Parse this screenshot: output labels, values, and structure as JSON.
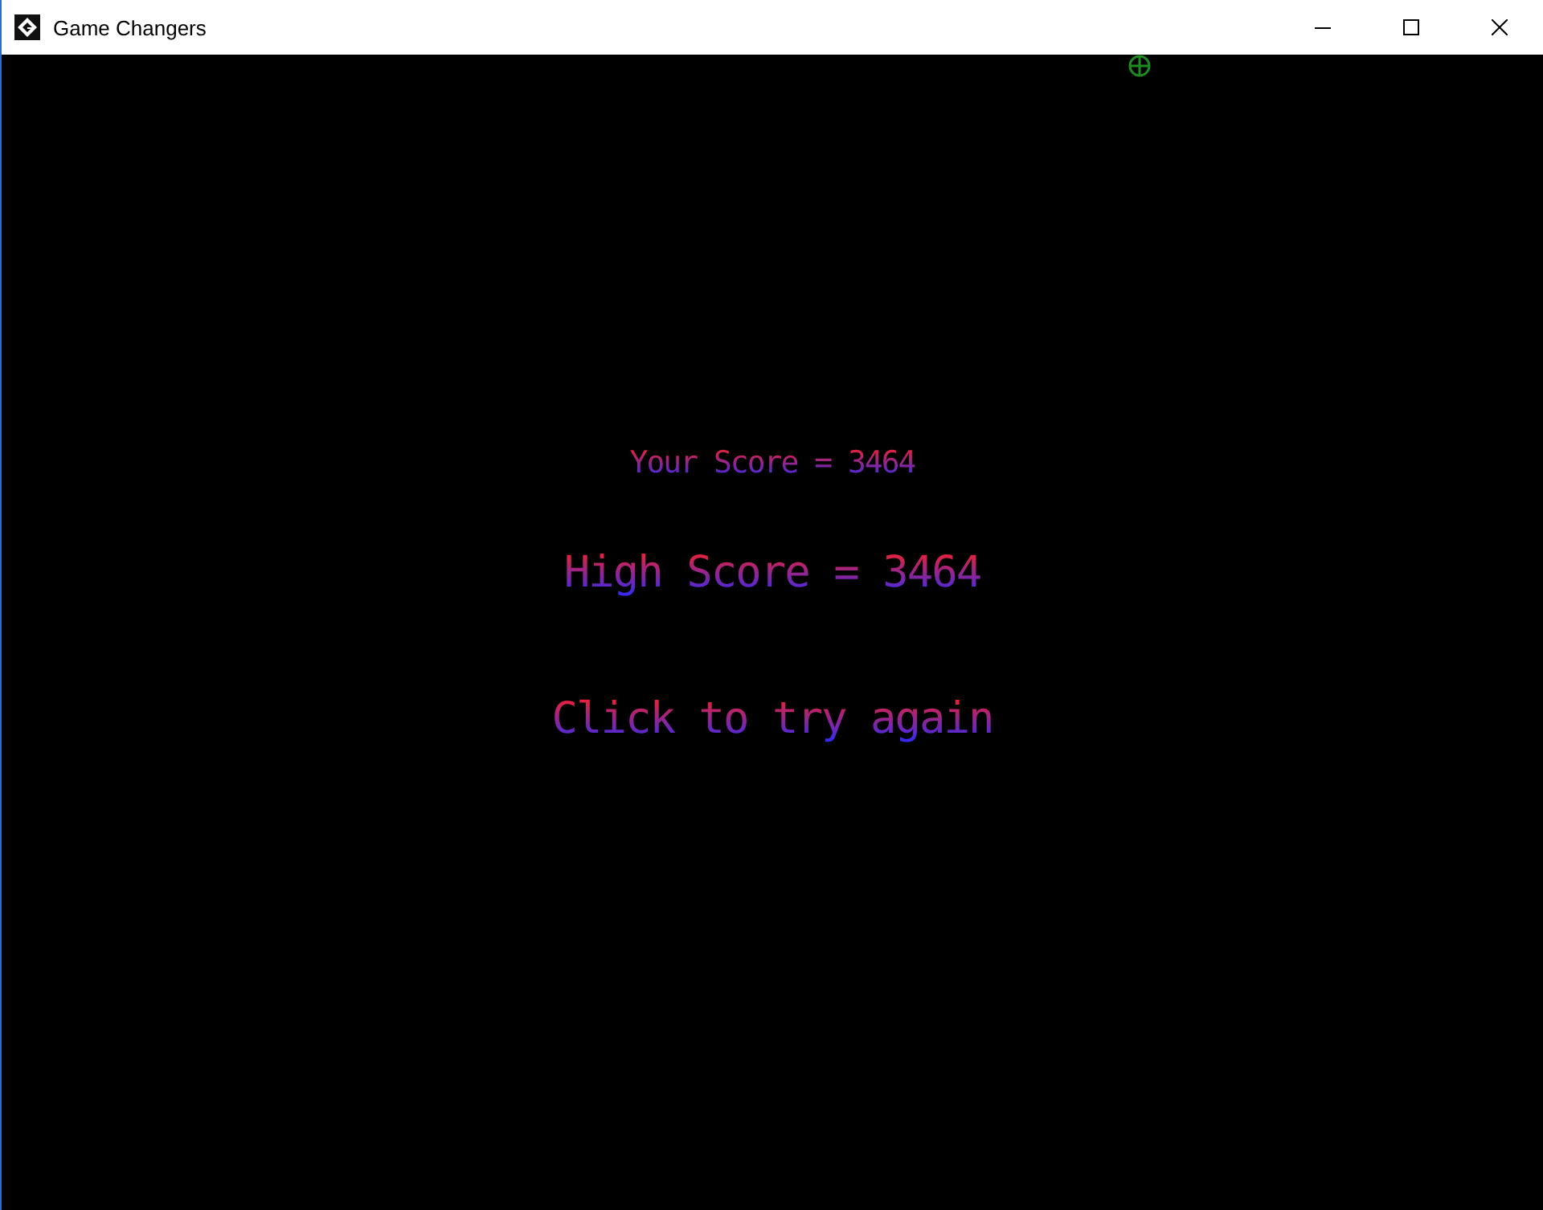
{
  "window": {
    "title": "Game Changers"
  },
  "screen": {
    "lines": [
      {
        "kind": "score",
        "text": "Your Score = 3464"
      },
      {
        "kind": "high",
        "text": "High Score = 3464"
      },
      {
        "kind": "prompt",
        "text": "Click to try again"
      }
    ]
  }
}
